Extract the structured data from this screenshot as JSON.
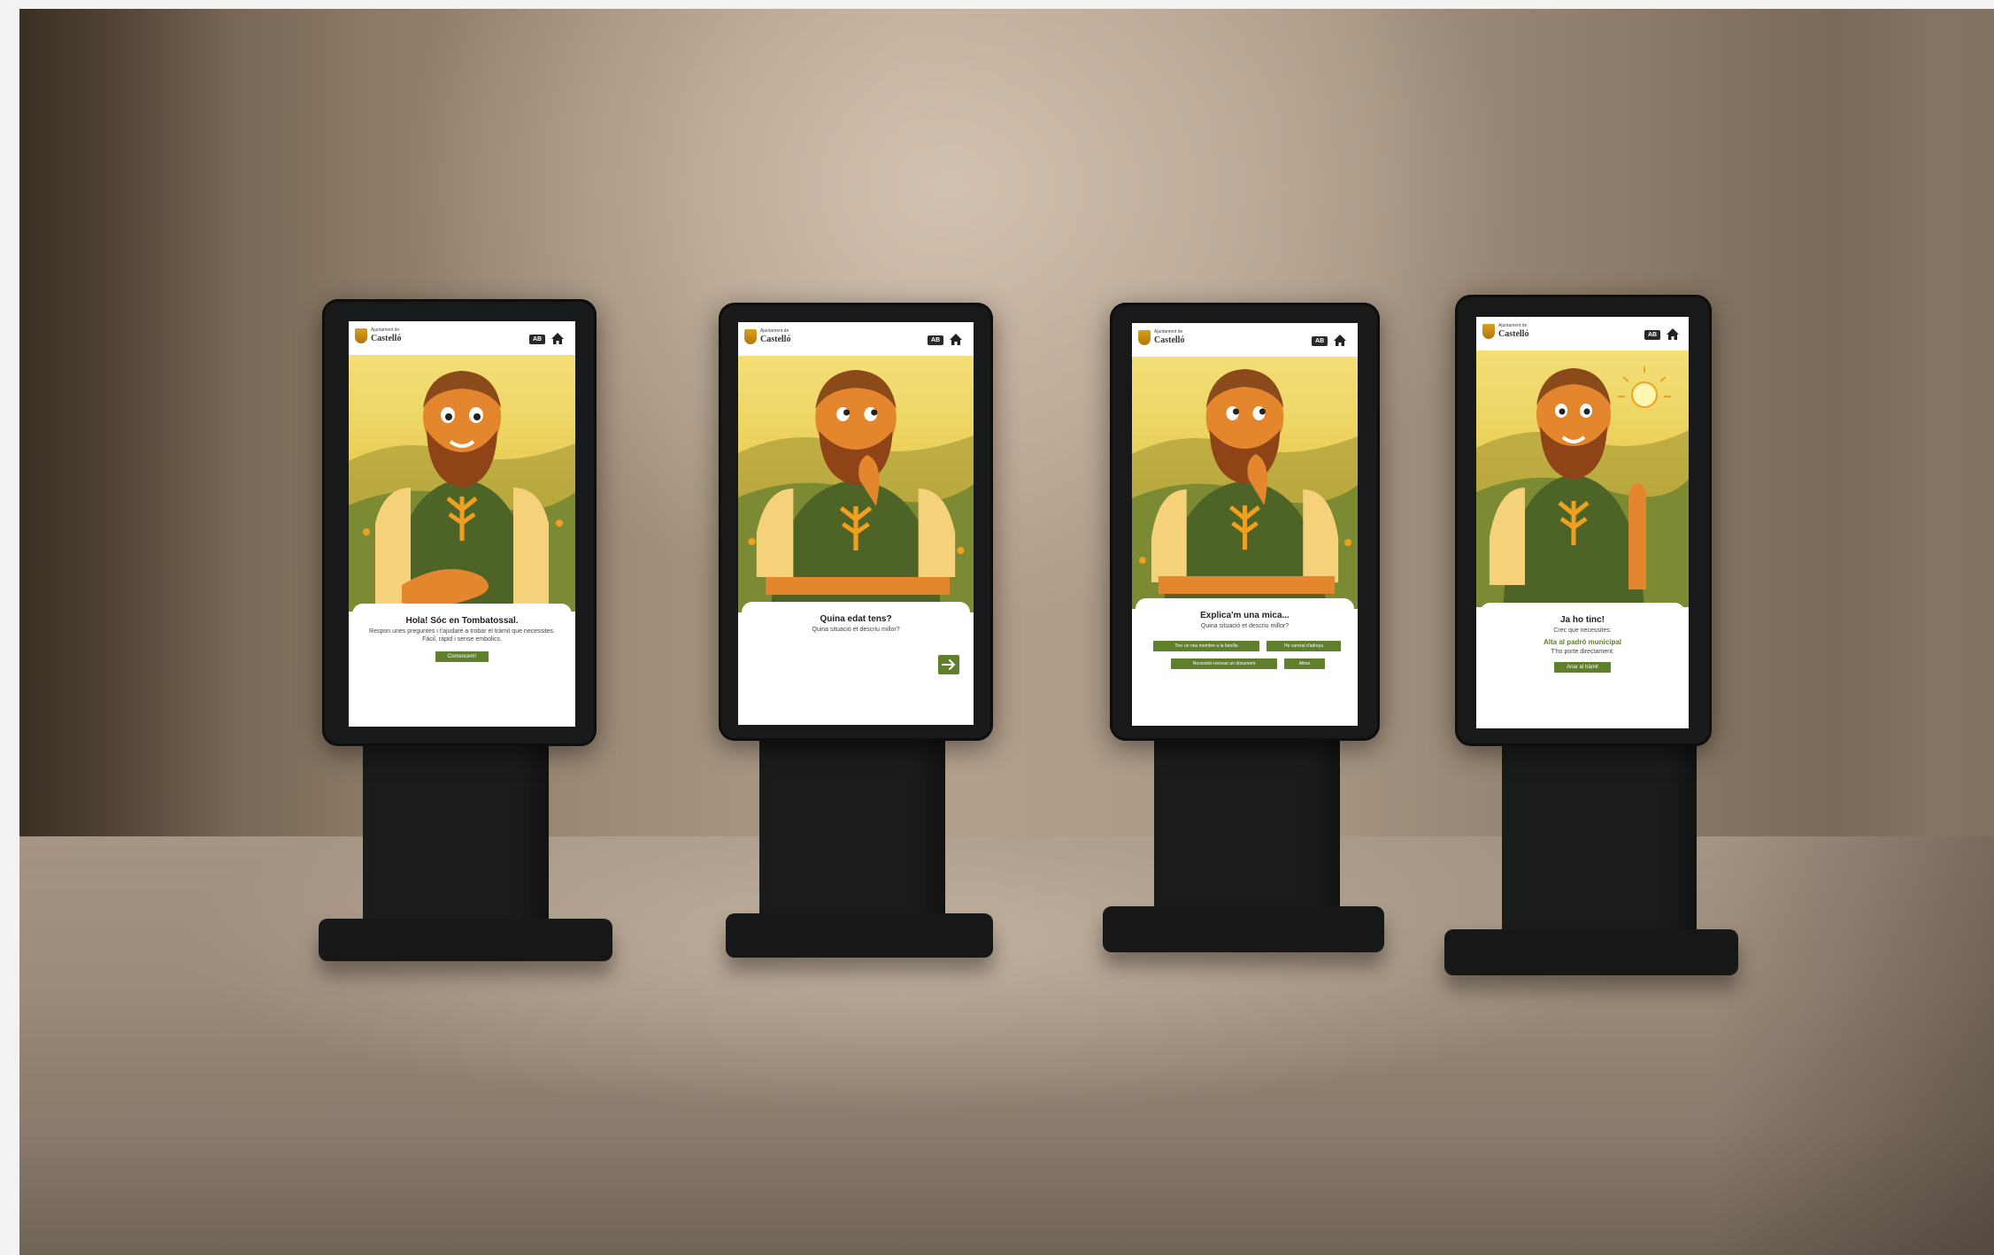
{
  "brand": {
    "small": "Ajuntament de",
    "name": "Castelló",
    "lang_icon": "AB",
    "home_icon": "home-icon",
    "accent": "#5f7f2c"
  },
  "kiosks": [
    {
      "title": "Hola! Sóc en Tombatossal.",
      "subtitle": "Respon unes preguntes i t'ajudaré a trobar el tràmit que necessites. Fàcil, ràpid i sense embolics.",
      "button": "Comencem!"
    },
    {
      "title": "Quina edat tens?",
      "subtitle": "Quina situació et descriu millor?",
      "button_icon": "arrow-right-icon"
    },
    {
      "title": "Explica'm una mica...",
      "subtitle": "Quina situació et descriu millor?",
      "options": [
        "Tinc un nou membre a la família",
        "He canviat d'adreça",
        "Necessito renovar un document",
        "Altres"
      ]
    },
    {
      "title": "Ja ho tinc!",
      "subtitle": "Crec que necessites:",
      "highlight": "Alta al padró municipal",
      "note": "T'ho porte directament.",
      "button": "Anar al tràmit"
    }
  ]
}
